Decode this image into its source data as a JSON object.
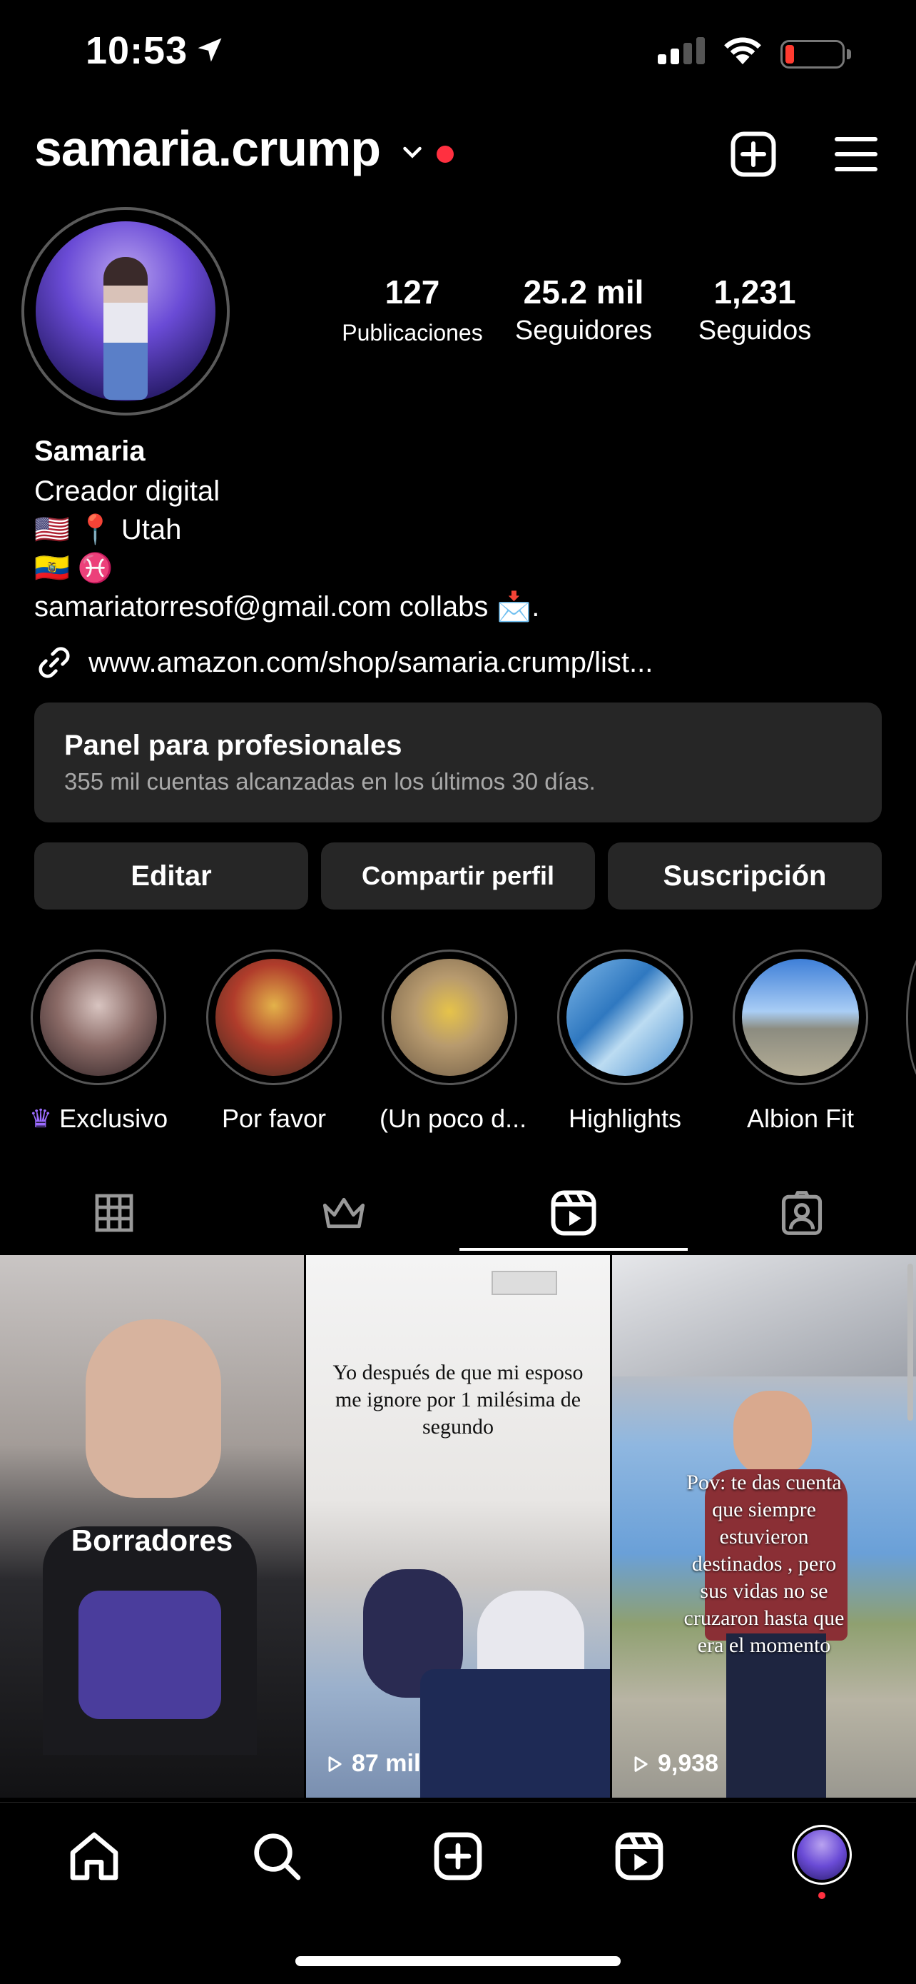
{
  "status_bar": {
    "time": "10:53"
  },
  "header": {
    "username": "samaria.crump"
  },
  "stats": [
    {
      "number": "127",
      "label": "Publicaciones"
    },
    {
      "number": "25.2 mil",
      "label": "Seguidores"
    },
    {
      "number": "1,231",
      "label": "Seguidos"
    }
  ],
  "bio": {
    "name": "Samaria",
    "category": "Creador digital",
    "line1": "🇺🇸 📍 Utah",
    "line2": "🇪🇨 ♓",
    "line3": "samariatorresof@gmail.com collabs 📩.",
    "link": "www.amazon.com/shop/samaria.crump/list..."
  },
  "panel": {
    "title": "Panel para profesionales",
    "subtitle": "355 mil cuentas alcanzadas en los últimos 30 días."
  },
  "buttons": {
    "edit": "Editar",
    "share": "Compartir perfil",
    "subscribe": "Suscripción"
  },
  "highlights": [
    {
      "label": "Exclusivo"
    },
    {
      "label": "Por favor"
    },
    {
      "label": "(Un poco d..."
    },
    {
      "label": "Highlights"
    },
    {
      "label": "Albion Fit"
    }
  ],
  "tabs": {
    "active": "reels"
  },
  "reels": [
    {
      "overlay": "Borradores"
    },
    {
      "caption": "Yo después de que mi esposo me ignore por 1 milésima de segundo",
      "views": "87 mil"
    },
    {
      "caption": "Pov: te das cuenta que siempre estuvieron destinados , pero sus vidas no se cruzaron hasta que era el momento",
      "views": "9,938"
    }
  ]
}
